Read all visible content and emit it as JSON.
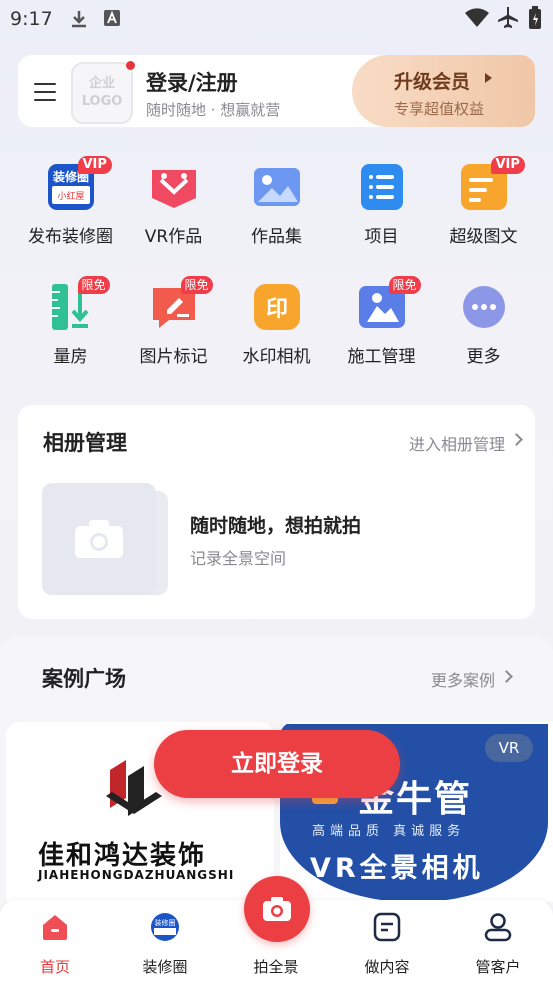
{
  "status_bar": {
    "time": "9:17"
  },
  "header": {
    "logo_text_line1": "企业",
    "logo_text_line2": "LOGO",
    "login_title": "登录/注册",
    "login_subtitle": "随时随地 · 想赢就营",
    "vip_title": "升级会员",
    "vip_subtitle": "专享超值权益"
  },
  "grid": [
    {
      "label": "发布装修圈",
      "badge": "VIP",
      "icon": "decoration-circle-icon"
    },
    {
      "label": "VR作品",
      "badge": "",
      "icon": "vr-works-icon"
    },
    {
      "label": "作品集",
      "badge": "",
      "icon": "portfolio-icon"
    },
    {
      "label": "项目",
      "badge": "",
      "icon": "project-icon"
    },
    {
      "label": "超级图文",
      "badge": "VIP",
      "icon": "super-article-icon"
    },
    {
      "label": "量房",
      "badge": "限免",
      "icon": "measure-room-icon"
    },
    {
      "label": "图片标记",
      "badge": "限免",
      "icon": "image-mark-icon"
    },
    {
      "label": "水印相机",
      "badge": "",
      "icon": "watermark-camera-icon"
    },
    {
      "label": "施工管理",
      "badge": "限免",
      "icon": "construction-icon"
    },
    {
      "label": "更多",
      "badge": "",
      "icon": "more-icon"
    }
  ],
  "icon_texts": {
    "decoration_top": "装修圈",
    "decoration_bottom": "小红屋",
    "watermark": "印"
  },
  "album": {
    "title": "相册管理",
    "link": "进入相册管理",
    "text1": "随时随地，想拍就拍",
    "text2": "记录全景空间"
  },
  "cases": {
    "title": "案例广场",
    "link": "更多案例",
    "card1_name": "佳和鸿达装饰",
    "card1_pinyin": "JIAHEHONGDAZHUANGSHI",
    "card2_brand": "金牛管",
    "card2_slogan": "高端品质  真诚服务",
    "card2_title": "VR全景相机",
    "vr_badge": "VR"
  },
  "login_button": "立即登录",
  "nav": [
    {
      "label": "首页",
      "icon": "home-icon",
      "active": true
    },
    {
      "label": "装修圈",
      "icon": "decoration-circle-nav-icon",
      "active": false
    },
    {
      "label": "拍全景",
      "icon": "camera-icon",
      "active": false
    },
    {
      "label": "做内容",
      "icon": "content-icon",
      "active": false
    },
    {
      "label": "管客户",
      "icon": "customer-icon",
      "active": false
    }
  ],
  "colors": {
    "accent": "#ec3f44",
    "vip_gold": "#f0c7a7",
    "vr_blue": "#2350a6"
  }
}
